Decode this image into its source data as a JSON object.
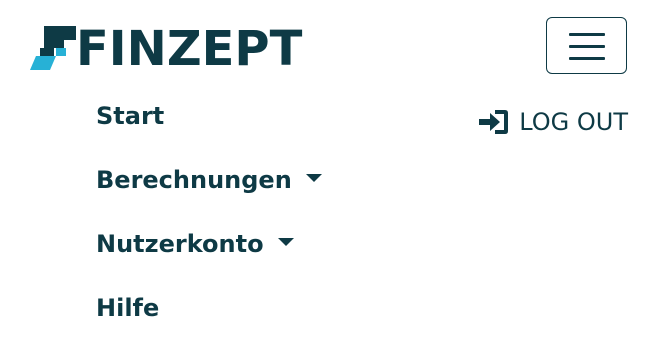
{
  "brand": {
    "name": "FINZEPT",
    "colors": {
      "primary": "#0e3a45",
      "accent": "#27b1d6"
    }
  },
  "header": {
    "toggler_icon": "hamburger-menu-icon"
  },
  "nav": {
    "items": [
      {
        "label": "Start",
        "has_dropdown": false
      },
      {
        "label": "Berechnungen",
        "has_dropdown": true
      },
      {
        "label": "Nutzerkonto",
        "has_dropdown": true
      },
      {
        "label": "Hilfe",
        "has_dropdown": false
      }
    ]
  },
  "logout": {
    "label": "LOG OUT",
    "icon": "sign-in-icon"
  }
}
